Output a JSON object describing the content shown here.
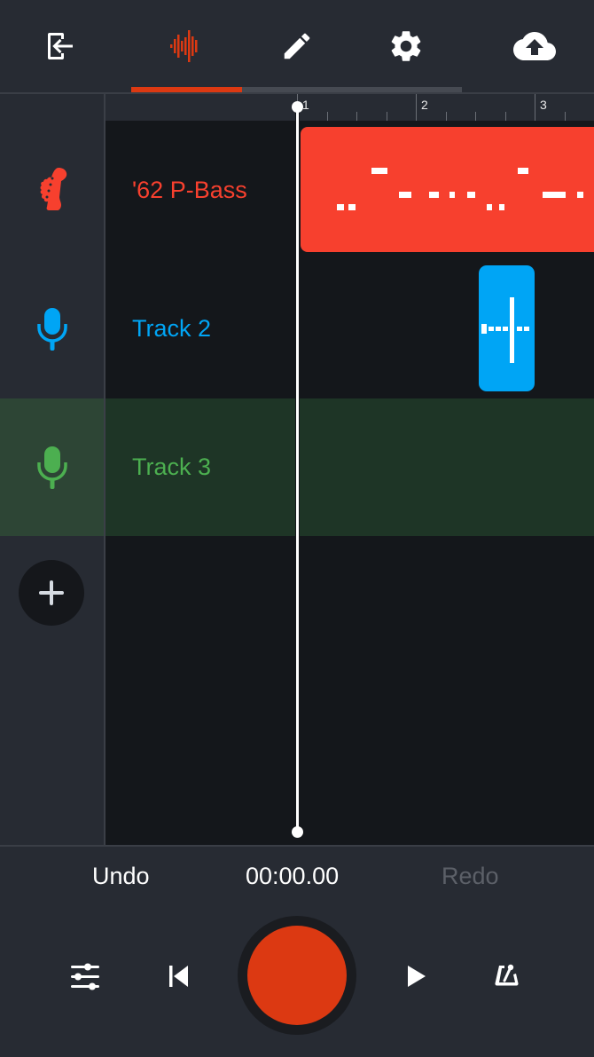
{
  "header": {
    "tabs": [
      {
        "name": "exit",
        "icon": "exit-icon",
        "active": false
      },
      {
        "name": "record",
        "icon": "waveform-icon",
        "active": true
      },
      {
        "name": "edit",
        "icon": "pencil-icon",
        "active": false
      },
      {
        "name": "settings",
        "icon": "gear-icon",
        "active": false
      },
      {
        "name": "upload",
        "icon": "cloud-upload-icon",
        "active": false
      }
    ],
    "accent_color": "#dc3912"
  },
  "ruler": {
    "measures": [
      "1",
      "2",
      "3"
    ]
  },
  "tracks": [
    {
      "name": "'62 P-Bass",
      "icon": "bass-headstock-icon",
      "color": "#f7402e",
      "selected": false
    },
    {
      "name": "Track 2",
      "icon": "microphone-icon",
      "color": "#00a5f5",
      "selected": false
    },
    {
      "name": "Track 3",
      "icon": "microphone-icon",
      "color": "#4caf50",
      "selected": true
    }
  ],
  "add_track": {
    "icon": "plus-icon"
  },
  "transport": {
    "undo_label": "Undo",
    "redo_label": "Redo",
    "redo_enabled": false,
    "time": "00:00.00",
    "buttons": [
      "mixer-sliders-icon",
      "skip-to-start-icon",
      "record-icon",
      "play-icon",
      "metronome-icon"
    ]
  }
}
